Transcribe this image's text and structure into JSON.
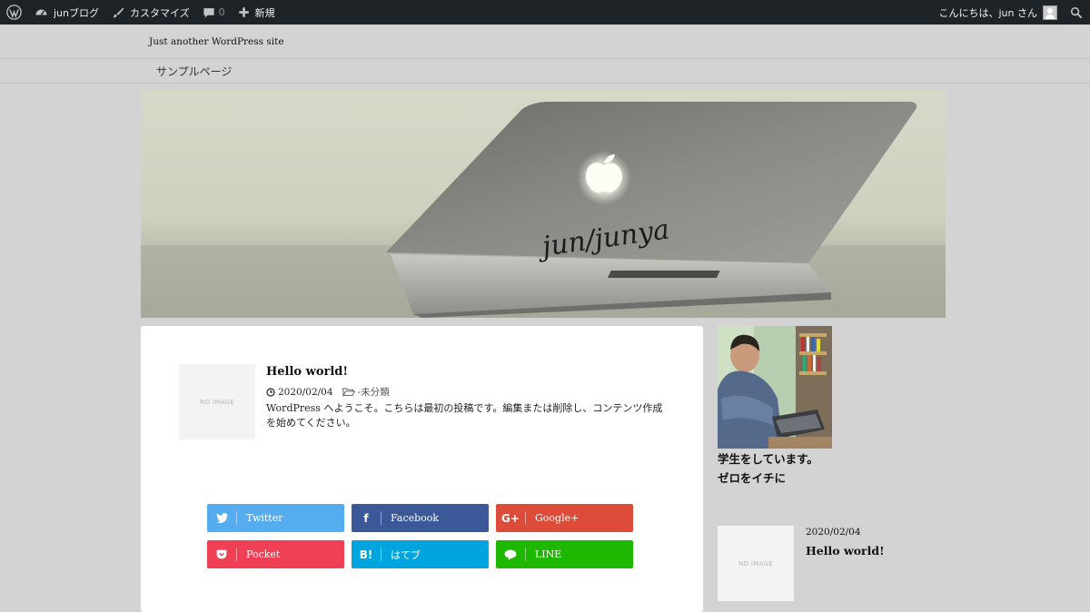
{
  "adminbar": {
    "site_name": "junブログ",
    "customize": "カスタマイズ",
    "comments": "0",
    "new": "新規",
    "greeting": "こんにちは、jun さん"
  },
  "header": {
    "description": "Just another WordPress site",
    "nav": [
      "サンプルページ"
    ]
  },
  "hero": {
    "signature": "jun/junya"
  },
  "post": {
    "thumb_label": "NO IMAGE",
    "title": "Hello world!",
    "date": "2020/02/04",
    "category": "未分類",
    "excerpt": "WordPress へようこそ。こちらは最初の投稿です。編集または削除し、コンテンツ作成を始めてください。"
  },
  "share": [
    {
      "label": "Twitter",
      "color": "#55acee",
      "icon": "twitter-icon"
    },
    {
      "label": "Facebook",
      "color": "#3b5998",
      "icon": "facebook-icon"
    },
    {
      "label": "Google+",
      "color": "#dd4b39",
      "icon": "google-plus-icon"
    },
    {
      "label": "Pocket",
      "color": "#ef4056",
      "icon": "pocket-icon"
    },
    {
      "label": "はてブ",
      "color": "#00a4de",
      "icon": "hatena-icon"
    },
    {
      "label": "LINE",
      "color": "#1fb800",
      "icon": "line-icon"
    }
  ],
  "share_glyphs": {
    "hatena": "B!",
    "google": "G+",
    "facebook": "f"
  },
  "sidebar": {
    "profile_line1": "学生をしています。",
    "profile_line2": "ゼロをイチに",
    "recent_thumb_label": "NO IMAGE",
    "recent_date": "2020/02/04",
    "recent_title": "Hello world!"
  }
}
